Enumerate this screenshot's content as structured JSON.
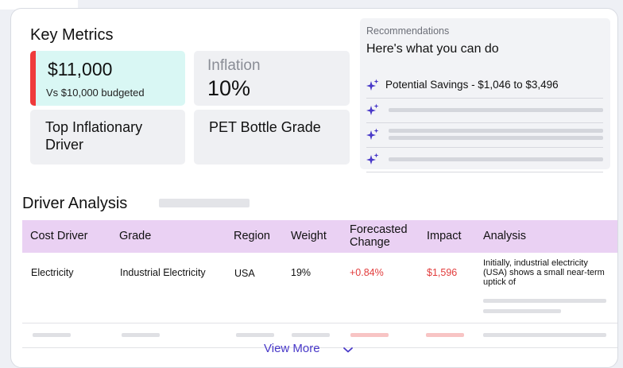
{
  "key_metrics": {
    "title": "Key Metrics",
    "spend": {
      "value": "$11,000",
      "sub": "Vs $10,000 budgeted",
      "accent": "#ef3b3b"
    },
    "inflation": {
      "label": "Inflation",
      "value": "10%"
    },
    "top_driver_label": "Top Inflationary Driver",
    "grade": "PET Bottle Grade"
  },
  "recommendations": {
    "label": "Recommendations",
    "title": "Here's what you can do",
    "items": [
      {
        "text": "Potential Savings - $1,046 to $3,496",
        "icon": "sparkle-icon"
      }
    ],
    "accent": "#4838c8"
  },
  "driver_analysis": {
    "title": "Driver Analysis",
    "columns": [
      "Cost Driver",
      "Grade",
      "Region",
      "Weight",
      "Forecasted Change",
      "Impact",
      "Analysis"
    ],
    "rows": [
      {
        "cost_driver": "Electricity",
        "grade": "Industrial Electricity",
        "region": "USA",
        "weight": "19%",
        "forecasted_change": "+0.84%",
        "impact": "$1,596",
        "analysis": "Initially, industrial electricity (USA) shows a small near-term uptick of"
      }
    ],
    "header_color": "#ead1f3",
    "negative_color": "#e23c3c"
  },
  "footer": {
    "view_more": "View More",
    "icon": "chevron-down-icon"
  }
}
